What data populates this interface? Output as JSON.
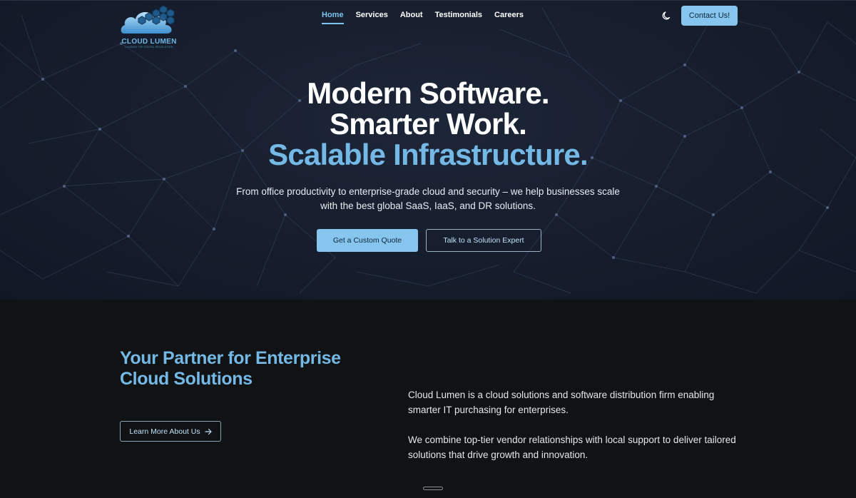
{
  "brand": {
    "name": "CLOUD LUMEN",
    "tagline": "LEADING THE DIGITAL REVOLUTION"
  },
  "nav": {
    "items": [
      {
        "label": "Home",
        "active": true
      },
      {
        "label": "Services",
        "active": false
      },
      {
        "label": "About",
        "active": false
      },
      {
        "label": "Testimonials",
        "active": false
      },
      {
        "label": "Careers",
        "active": false
      }
    ],
    "theme_icon": "moon-icon",
    "contact_label": "Contact Us!"
  },
  "hero": {
    "title_line1": "Modern Software.",
    "title_line2": "Smarter Work.",
    "title_line3": "Scalable Infrastructure.",
    "subtitle": "From office productivity to enterprise-grade cloud and security – we help businesses scale with the best global SaaS, IaaS, and DR solutions.",
    "primary_cta": "Get a Custom Quote",
    "secondary_cta": "Talk to a Solution Expert"
  },
  "about": {
    "title": "Your Partner for Enterprise Cloud Solutions",
    "cta": "Learn More About Us",
    "cta_icon": "arrow-right-icon",
    "paragraph1": "Cloud Lumen is a cloud solutions and software distribution firm enabling smarter IT purchasing for enterprises.",
    "paragraph2": "We combine top-tier vendor relationships with local support to deliver tailored solutions that drive growth and innovation."
  },
  "colors": {
    "accent": "#74b9e6",
    "button_bg": "#86c6ee",
    "hero_bg": "#161d2c",
    "section_bg": "#111214"
  }
}
